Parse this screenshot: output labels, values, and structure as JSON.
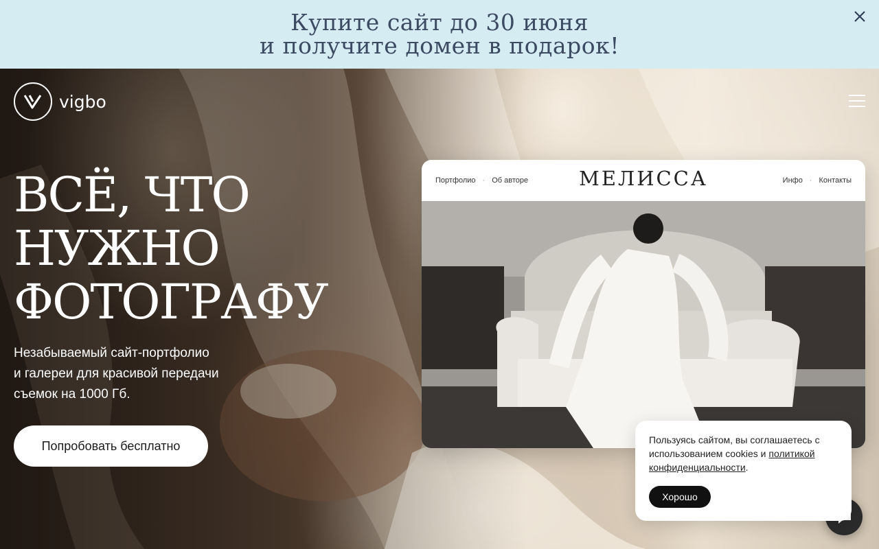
{
  "promo": {
    "line1": "Купите сайт до 30 июня",
    "line2": "и получите домен в подарок!",
    "close_icon": "close-icon",
    "background": "#d6ecf3"
  },
  "header": {
    "logo_text": "vigbo",
    "menu_icon": "hamburger-menu-icon"
  },
  "hero": {
    "headline": [
      "ВСЁ, ЧТО",
      "НУЖНО",
      "ФОТОГРАФУ"
    ],
    "subtext": [
      "Незабываемый сайт-портфолио",
      "и галереи для красивой передачи",
      "съемок на 1000 Гб."
    ],
    "cta_label": "Попробовать бесплатно"
  },
  "preview": {
    "brand": "МЕЛИССА",
    "nav_left": [
      "Портфолио",
      "Об авторе"
    ],
    "nav_right": [
      "Инфо",
      "Контакты"
    ],
    "separator": "·"
  },
  "cookie": {
    "text": "Пользуясь сайтом, вы соглашаетесь с использованием cookies и ",
    "link": "политикой конфиденциальности",
    "tail": ".",
    "ok_label": "Хорошо"
  },
  "chat": {
    "icon": "chat-bubble-icon"
  }
}
